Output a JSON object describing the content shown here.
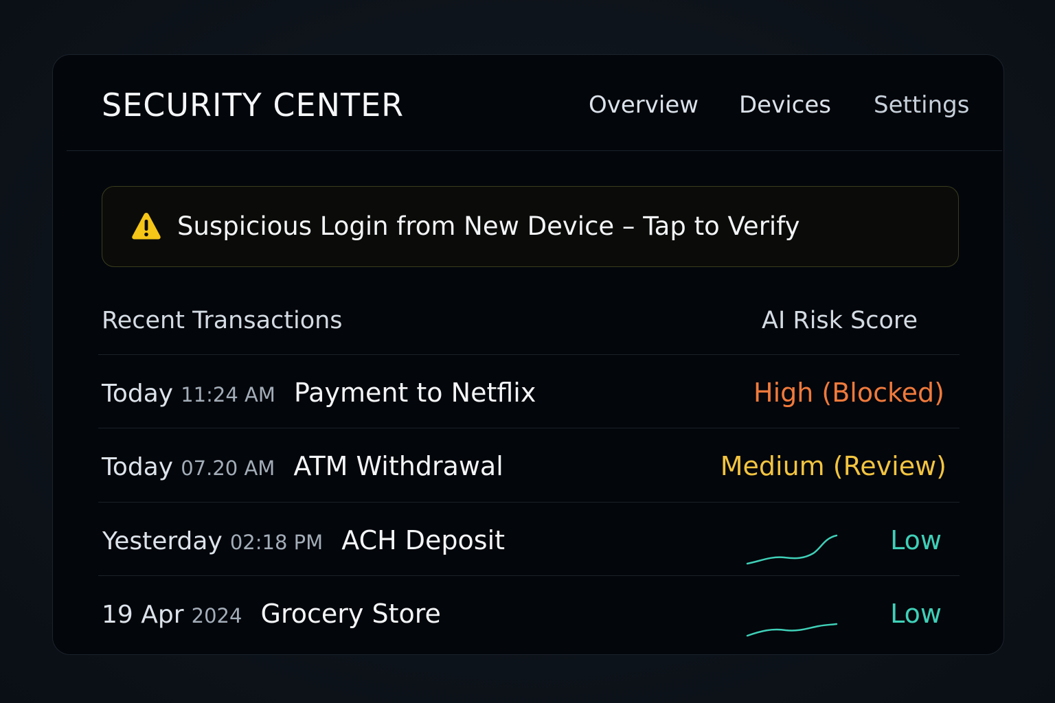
{
  "app": {
    "title": "SECURITY CENTER"
  },
  "nav": {
    "tabs": [
      {
        "label": "Overview"
      },
      {
        "label": "Devices"
      },
      {
        "label": "Settings"
      }
    ]
  },
  "alert": {
    "icon": "warning-triangle-icon",
    "text": "Suspicious Login from New Device – Tap to Verify",
    "accent_color": "#f5c518"
  },
  "transactions": {
    "heading": "Recent Transactions",
    "score_heading": "AI Risk Score",
    "rows": [
      {
        "day": "Today",
        "time": "11:24 AM",
        "description": "Payment to Netflix",
        "risk": "High (Blocked)",
        "risk_level": "high"
      },
      {
        "day": "Today",
        "time": "07.20 AM",
        "description": "ATM Withdrawal",
        "risk": "Medium (Review)",
        "risk_level": "medium"
      },
      {
        "day": "Yesterday",
        "time": "02:18 PM",
        "description": "ACH Deposit",
        "risk": "Low",
        "risk_level": "low",
        "trend": "rising"
      },
      {
        "day": "19 Apr",
        "time": "2024",
        "description": "Grocery Store",
        "risk": "Low",
        "risk_level": "low",
        "trend": "flat"
      }
    ]
  },
  "colors": {
    "high": "#f07a3c",
    "medium": "#f2c440",
    "low": "#3fd0b8"
  }
}
